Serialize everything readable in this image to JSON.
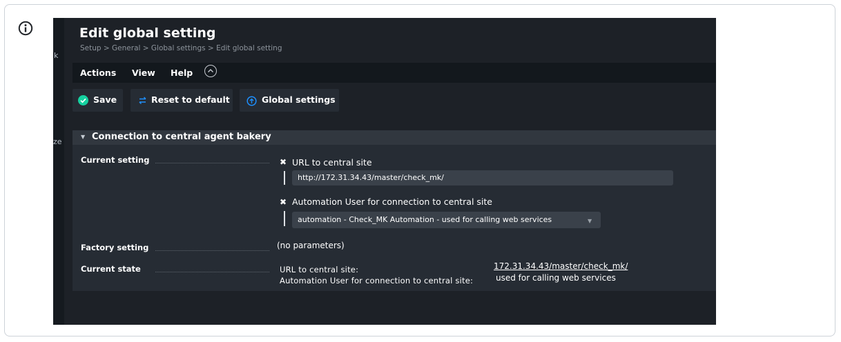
{
  "page": {
    "title": "Edit global setting",
    "breadcrumb": "Setup > General > Global settings > Edit global setting"
  },
  "sidebar": {
    "fragments": [
      "k",
      "ze"
    ]
  },
  "menu": {
    "items": [
      "Actions",
      "View",
      "Help"
    ]
  },
  "toolbar": {
    "save_label": "Save",
    "reset_label": "Reset to default",
    "global_label": "Global settings"
  },
  "section": {
    "title": "Connection to central agent bakery",
    "current_setting_label": "Current setting",
    "factory_setting_label": "Factory setting",
    "current_state_label": "Current state",
    "url_checkbox_label": "URL to central site",
    "url_value": "http://172.31.34.43/master/check_mk/",
    "automation_checkbox_label": "Automation User for connection to central site",
    "automation_selected": "automation - Check_MK Automation - used for calling web services",
    "factory_value": "(no parameters)",
    "state": {
      "url_key": "URL to central site:",
      "url_value": "172.31.34.43/master/check_mk/",
      "automation_key": "Automation User for connection to central site:",
      "automation_value": "used for calling web services"
    }
  },
  "icons": [
    "info-icon",
    "save-check-icon",
    "reset-arrows-icon",
    "global-settings-icon",
    "collapse-chevron-icon",
    "checkbox-checked-icon",
    "dropdown-arrow-icon",
    "section-collapse-arrow-icon"
  ],
  "colors": {
    "background": "#1d2127",
    "panel": "#262c34",
    "menubar": "#13181d",
    "save_green": "#15d1a0",
    "accent_blue": "#1e90ff"
  }
}
